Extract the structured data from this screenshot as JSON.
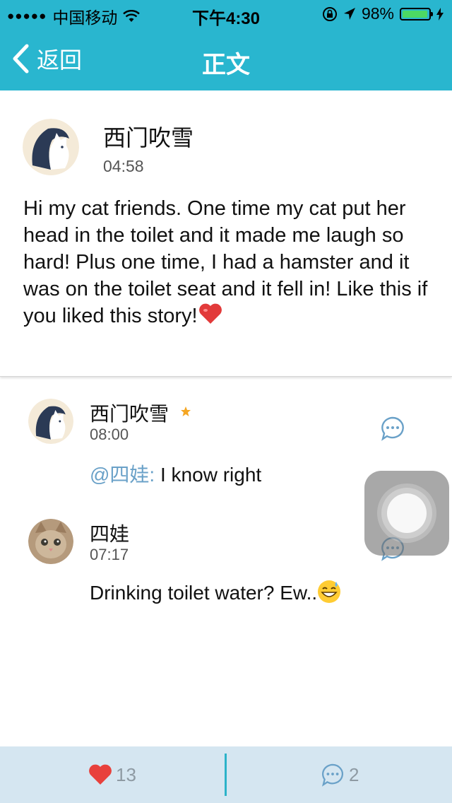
{
  "status_bar": {
    "signal_dots": "●●●●●",
    "carrier": "中国移动",
    "time": "下午4:30",
    "battery_percent": "98%",
    "battery_level": 0.98,
    "battery_color": "#4cd964"
  },
  "nav": {
    "back_label": "返回",
    "title": "正文",
    "background": "#29b6cf"
  },
  "post": {
    "author": "西门吹雪",
    "time": "04:58",
    "text": "Hi my cat friends. One time my cat put her head in the toilet and it made me laugh so hard! Plus one time, I had a hamster and it was on the toilet seat and it fell in! Like this if you liked this story!",
    "emoji": "red-heart"
  },
  "comments": [
    {
      "author": "西门吹雪",
      "badge": "star",
      "time": "08:00",
      "mention": "@四娃:",
      "text": " I know right"
    },
    {
      "author": "四娃",
      "time": "07:17",
      "text": "Drinking toilet water? Ew..",
      "emoji": "grinning-sweat"
    }
  ],
  "bottom_bar": {
    "like_count": "13",
    "comment_count": "2",
    "heart_color": "#e8413c",
    "divider_color": "#2cb3c9"
  },
  "icons": {
    "back": "chevron-left-icon",
    "wifi": "wifi-icon",
    "lock_rotation": "rotation-lock-icon",
    "location": "location-arrow-icon",
    "charging": "charging-bolt-icon",
    "reply": "speech-bubble-icon",
    "like": "heart-icon",
    "star": "star-icon"
  }
}
